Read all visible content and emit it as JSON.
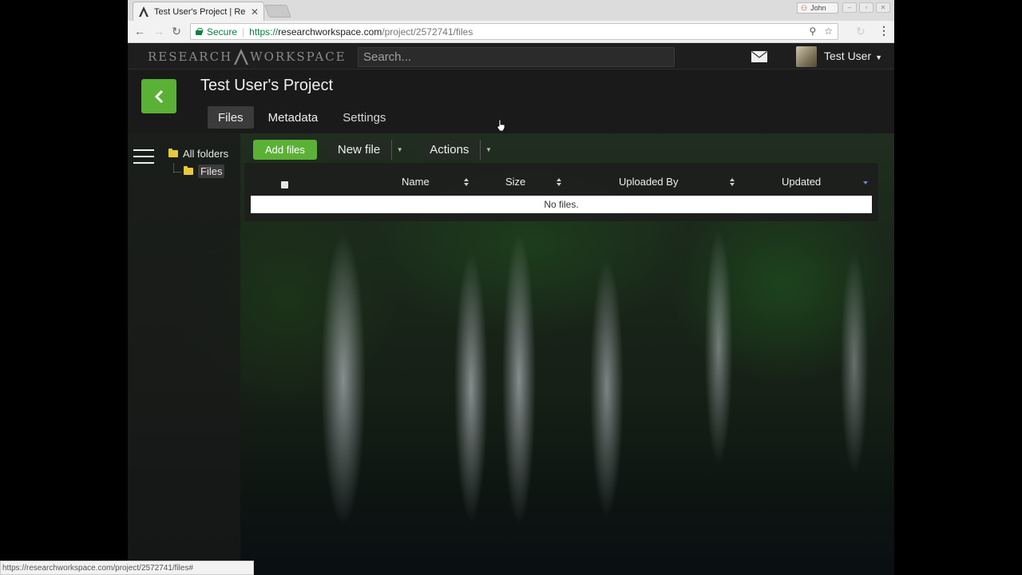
{
  "browser": {
    "tab_title": "Test User's Project | Re",
    "profile_name": "John",
    "secure_label": "Secure",
    "url_scheme": "https://",
    "url_host": "researchworkspace.com",
    "url_path": "/project/2572741/files",
    "status_url": "https://researchworkspace.com/project/2572741/files#"
  },
  "app": {
    "logo_left": "RESEARCH",
    "logo_right": "WORKSPACE",
    "search_placeholder": "Search...",
    "user_name": "Test User",
    "accent_color": "#5bb135"
  },
  "project": {
    "title": "Test User's Project",
    "tabs": [
      {
        "label": "Files",
        "active": true
      },
      {
        "label": "Metadata",
        "active": false
      },
      {
        "label": "Settings",
        "active": false
      }
    ]
  },
  "sidebar": {
    "tree": [
      {
        "label": "All folders"
      },
      {
        "label": "Files"
      }
    ]
  },
  "files": {
    "add_label": "Add files",
    "new_label": "New file",
    "actions_label": "Actions",
    "columns": [
      "Name",
      "Size",
      "Uploaded By",
      "Updated"
    ],
    "empty_message": "No files."
  }
}
